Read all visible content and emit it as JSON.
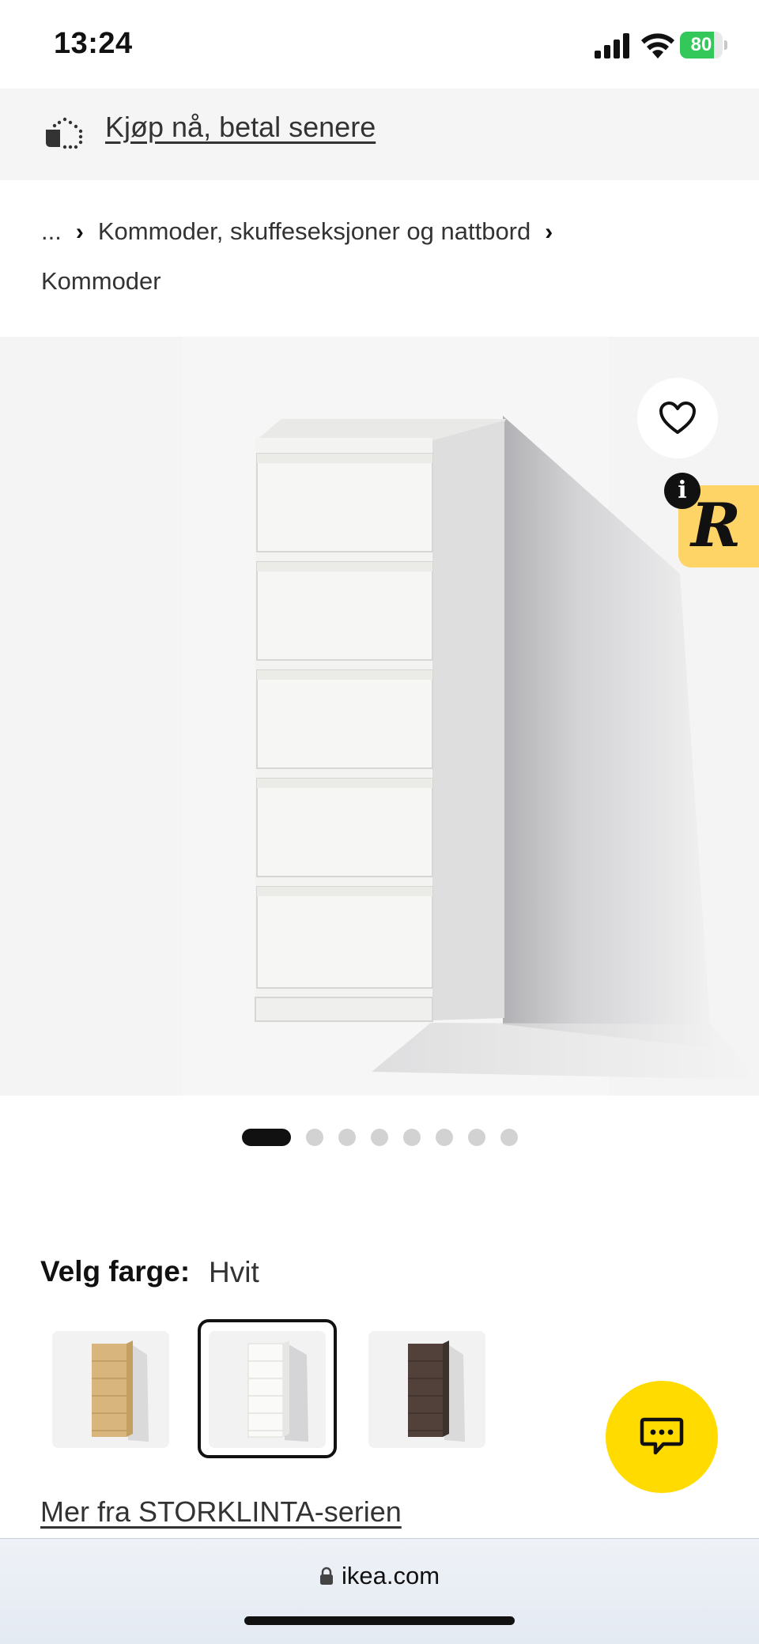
{
  "status_bar": {
    "time": "13:24",
    "battery": "80",
    "battery_level": 0.8,
    "battery_color": "#34c759"
  },
  "promo": {
    "text": "Kjøp nå, betal senere"
  },
  "breadcrumb": {
    "ellipsis": "...",
    "separator": "›",
    "category": "Kommoder, skuffeseksjoner og nattbord",
    "current": "Kommoder"
  },
  "product_image": {
    "alt": "Kommode med 6 skuffer, hvit"
  },
  "gallery": {
    "count": 8,
    "active": 1
  },
  "color_select": {
    "label": "Velg farge:",
    "value": "Hvit",
    "options": [
      {
        "name": "eik",
        "color": "#cfa96b"
      },
      {
        "name": "hvit",
        "color": "#f2f2ef",
        "selected": true
      },
      {
        "name": "brun",
        "color": "#4a3b33"
      }
    ]
  },
  "series_link": "Mer fra STORKLINTA-serien",
  "browser": {
    "url": "ikea.com"
  },
  "colors": {
    "accent_yellow": "#ffdb00",
    "badge_yellow": "#ffd466"
  }
}
